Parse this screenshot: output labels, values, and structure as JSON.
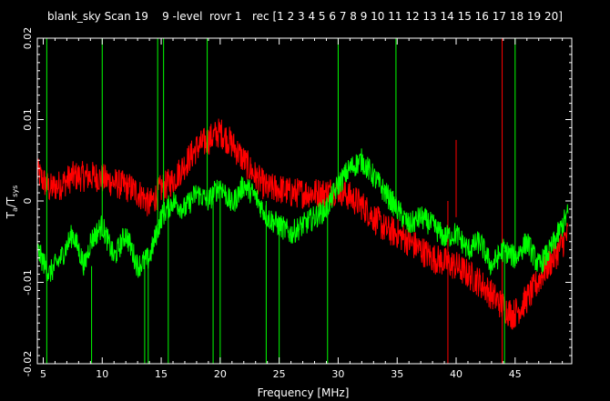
{
  "chart_data": {
    "type": "line",
    "title": "blank_sky Scan 19    9 -level  rovr 1   rec [1 2 3 4 5 6 7 8 9 10 11 12 13 14 15 16 17 18 19 20]",
    "xlabel": "Frequency [MHz]",
    "ylabel": "T_a/T_sys",
    "ylabel_parts": {
      "base1": "T",
      "sub1": "a",
      "slash": "/",
      "base2": "T",
      "sub2": "sys"
    },
    "xlim": [
      4.5,
      49.8
    ],
    "ylim": [
      -0.02,
      0.02
    ],
    "x_ticks": [
      5,
      10,
      15,
      20,
      25,
      30,
      35,
      40,
      45
    ],
    "x_tick_labels": [
      "5",
      "10",
      "15",
      "20",
      "25",
      "30",
      "35",
      "40",
      "45"
    ],
    "y_ticks": [
      -0.02,
      -0.01,
      0,
      0.01,
      0.02
    ],
    "y_tick_labels": [
      "-0.02",
      "-0.01",
      "0",
      "0.01",
      "0.02"
    ],
    "grid": false,
    "background": "#000000",
    "axis_color": "#ffffff",
    "series": [
      {
        "color": "#ff0000",
        "noise": 0.0019,
        "x": [
          4.5,
          5.5,
          6.5,
          7.5,
          8.5,
          9.5,
          10.5,
          11.5,
          12.5,
          13.5,
          14.0,
          15.0,
          16.0,
          17.0,
          18.0,
          19.0,
          20.0,
          21.0,
          22.0,
          23.0,
          24.0,
          25.0,
          26.0,
          27.0,
          28.0,
          29.0,
          30.0,
          31.0,
          32.0,
          33.0,
          34.0,
          35.0,
          36.0,
          37.0,
          38.0,
          39.0,
          40.0,
          41.0,
          42.0,
          43.0,
          44.0,
          44.8,
          45.5,
          46.5,
          47.5,
          48.5,
          49.5
        ],
        "y": [
          0.0035,
          0.0015,
          0.002,
          0.003,
          0.003,
          0.003,
          0.0025,
          0.002,
          0.0015,
          0.0005,
          -0.0005,
          0.0015,
          0.0025,
          0.0045,
          0.0065,
          0.0075,
          0.0085,
          0.007,
          0.005,
          0.003,
          0.0015,
          0.0015,
          0.001,
          0.001,
          0.001,
          0.001,
          0.0015,
          0.0005,
          -0.0005,
          -0.002,
          -0.0035,
          -0.004,
          -0.005,
          -0.006,
          -0.007,
          -0.0075,
          -0.008,
          -0.009,
          -0.01,
          -0.0115,
          -0.013,
          -0.014,
          -0.013,
          -0.011,
          -0.0085,
          -0.0065,
          -0.004
        ],
        "spikes": [
          {
            "x": 39.3,
            "y1": 0.0,
            "y2": -0.02
          },
          {
            "x": 40.0,
            "y1": -0.002,
            "y2": 0.0075
          },
          {
            "x": 43.9,
            "y1": 0.02,
            "y2": -0.02
          }
        ]
      },
      {
        "color": "#00ff00",
        "noise": 0.0015,
        "x": [
          4.5,
          5.5,
          6.5,
          7.5,
          8.5,
          9.0,
          10.0,
          11.0,
          12.0,
          13.0,
          14.0,
          15.0,
          16.0,
          17.0,
          18.0,
          19.0,
          20.0,
          21.0,
          22.0,
          23.0,
          24.0,
          25.0,
          26.0,
          27.0,
          28.0,
          29.0,
          30.0,
          31.0,
          32.0,
          33.0,
          34.0,
          35.0,
          36.0,
          37.0,
          38.0,
          39.0,
          40.0,
          41.0,
          42.0,
          43.0,
          44.0,
          45.0,
          46.0,
          47.0,
          48.0,
          49.0,
          49.5
        ],
        "y": [
          -0.006,
          -0.009,
          -0.007,
          -0.004,
          -0.008,
          -0.005,
          -0.003,
          -0.007,
          -0.004,
          -0.008,
          -0.007,
          -0.002,
          0.0,
          -0.001,
          0.001,
          0.0,
          0.002,
          -0.0005,
          0.002,
          0.0005,
          -0.002,
          -0.003,
          -0.004,
          -0.003,
          -0.002,
          -0.001,
          0.002,
          0.004,
          0.005,
          0.003,
          0.001,
          -0.001,
          -0.003,
          -0.002,
          -0.003,
          -0.0045,
          -0.004,
          -0.006,
          -0.005,
          -0.008,
          -0.006,
          -0.007,
          -0.005,
          -0.008,
          -0.006,
          -0.003,
          -0.0015
        ],
        "spikes": [
          {
            "x": 5.3,
            "y1": -0.008,
            "y2": -0.02
          },
          {
            "x": 5.3,
            "y1": -0.008,
            "y2": 0.02
          },
          {
            "x": 9.1,
            "y1": -0.008,
            "y2": -0.02
          },
          {
            "x": 10.0,
            "y1": -0.004,
            "y2": 0.02
          },
          {
            "x": 13.6,
            "y1": -0.007,
            "y2": -0.02
          },
          {
            "x": 13.9,
            "y1": -0.006,
            "y2": -0.02
          },
          {
            "x": 14.7,
            "y1": -0.003,
            "y2": 0.02
          },
          {
            "x": 15.2,
            "y1": -0.002,
            "y2": 0.02
          },
          {
            "x": 15.6,
            "y1": -0.001,
            "y2": -0.02
          },
          {
            "x": 18.9,
            "y1": 0.0,
            "y2": 0.02
          },
          {
            "x": 19.4,
            "y1": 0.0,
            "y2": -0.02
          },
          {
            "x": 20.0,
            "y1": 0.002,
            "y2": -0.02
          },
          {
            "x": 23.9,
            "y1": 0.0,
            "y2": -0.02
          },
          {
            "x": 25.0,
            "y1": -0.002,
            "y2": -0.02
          },
          {
            "x": 29.1,
            "y1": -0.001,
            "y2": -0.02
          },
          {
            "x": 30.0,
            "y1": 0.002,
            "y2": 0.02
          },
          {
            "x": 34.9,
            "y1": -0.001,
            "y2": 0.02
          },
          {
            "x": 44.1,
            "y1": -0.006,
            "y2": -0.02
          },
          {
            "x": 45.0,
            "y1": -0.007,
            "y2": 0.02
          }
        ]
      }
    ]
  }
}
